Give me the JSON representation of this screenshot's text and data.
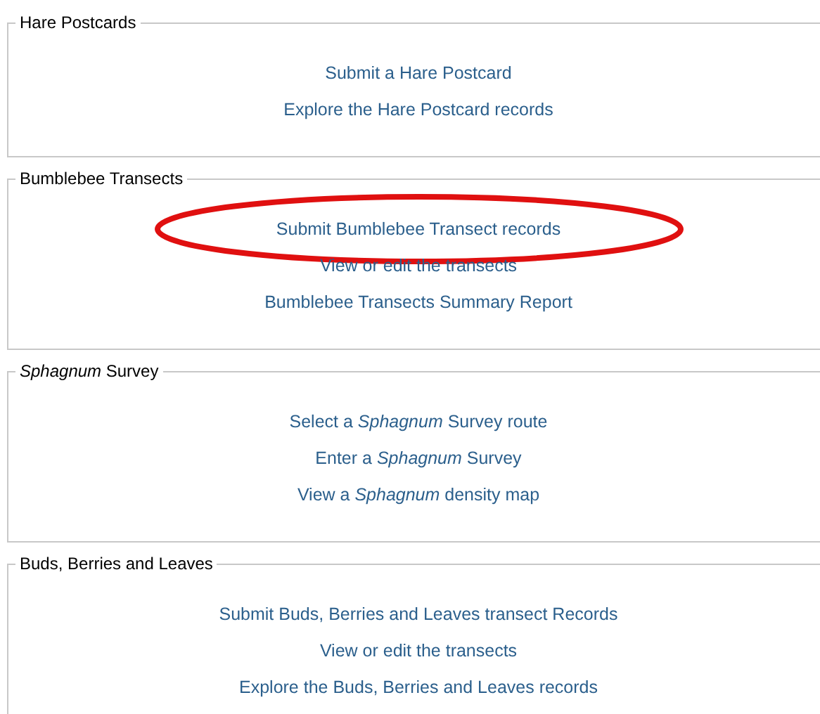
{
  "sections": [
    {
      "legend": "Hare Postcards",
      "links": [
        {
          "text": "Submit a Hare Postcard",
          "highlighted": false
        },
        {
          "text": "Explore the Hare Postcard records",
          "highlighted": false
        }
      ]
    },
    {
      "legend": "Bumblebee Transects",
      "links": [
        {
          "text": "Submit Bumblebee Transect records",
          "highlighted": true
        },
        {
          "text": "View or edit the transects",
          "highlighted": false
        },
        {
          "text": "Bumblebee Transects Summary Report",
          "highlighted": false
        }
      ]
    },
    {
      "legend": "*Sphagnum* Survey",
      "links": [
        {
          "text": "Select a *Sphagnum* Survey route",
          "highlighted": false
        },
        {
          "text": "Enter a *Sphagnum* Survey",
          "highlighted": false
        },
        {
          "text": "View a *Sphagnum* density map",
          "highlighted": false
        }
      ]
    },
    {
      "legend": "Buds, Berries and Leaves",
      "links": [
        {
          "text": "Submit Buds, Berries and Leaves transect Records",
          "highlighted": false
        },
        {
          "text": "View or edit the transects",
          "highlighted": false
        },
        {
          "text": "Explore the Buds, Berries and Leaves records",
          "highlighted": false
        }
      ]
    }
  ]
}
